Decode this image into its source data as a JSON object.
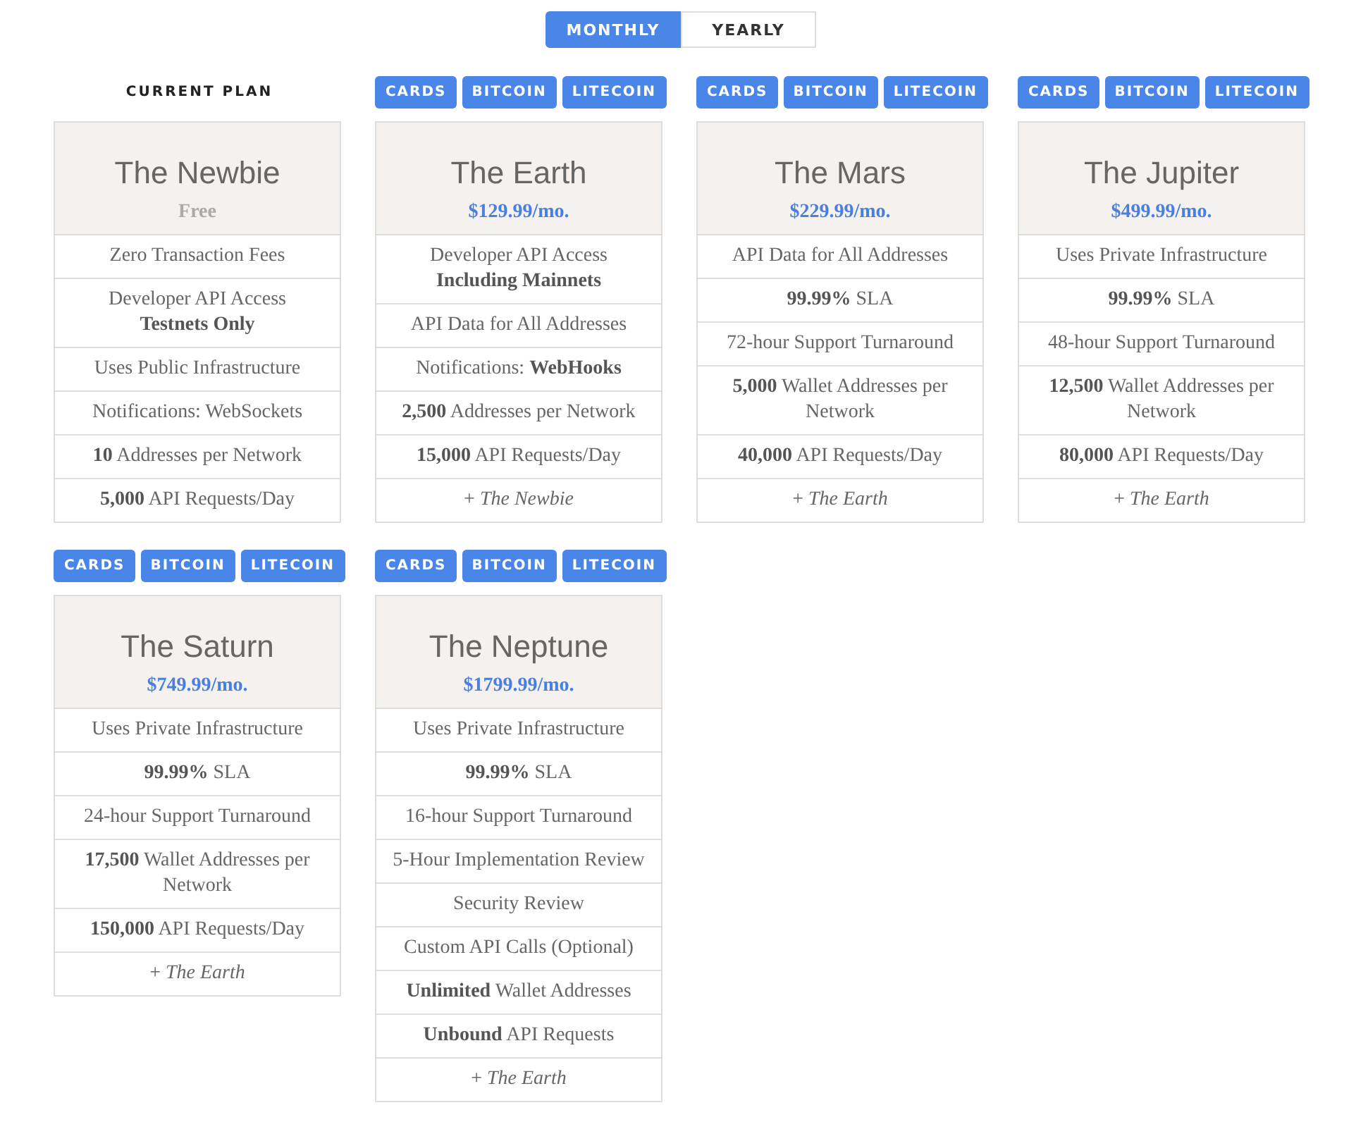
{
  "billing_toggle": [
    {
      "label": "MONTHLY",
      "selected": true
    },
    {
      "label": "YEARLY",
      "selected": false
    }
  ],
  "plans": [
    {
      "kind": "current",
      "label": "CURRENT PLAN",
      "name": "The Newbie",
      "price": "Free",
      "free": true,
      "features": [
        "Zero Transaction Fees",
        "Developer API Access\n**Testnets Only**",
        "Uses Public Infrastructure",
        "Notifications: WebSockets",
        "**10** Addresses per Network",
        "**5,000** API Requests/Day"
      ]
    },
    {
      "kind": "purchasable",
      "payment_buttons": [
        "CARDS",
        "BITCOIN",
        "LITECOIN"
      ],
      "name": "The Earth",
      "price": "$129.99/mo.",
      "free": false,
      "features": [
        "Developer API Access\n**Including Mainnets**",
        "API Data for All Addresses",
        "Notifications: **WebHooks**",
        "**2,500** Addresses per Network",
        "**15,000** API Requests/Day",
        "+ *The Newbie*"
      ]
    },
    {
      "kind": "purchasable",
      "payment_buttons": [
        "CARDS",
        "BITCOIN",
        "LITECOIN"
      ],
      "name": "The Mars",
      "price": "$229.99/mo.",
      "free": false,
      "features": [
        "API Data for All Addresses",
        "**99.99%** SLA",
        "72-hour Support Turnaround",
        "**5,000** Wallet Addresses per Network",
        "**40,000** API Requests/Day",
        "+ *The Earth*"
      ]
    },
    {
      "kind": "purchasable",
      "payment_buttons": [
        "CARDS",
        "BITCOIN",
        "LITECOIN"
      ],
      "name": "The Jupiter",
      "price": "$499.99/mo.",
      "free": false,
      "features": [
        "Uses Private Infrastructure",
        "**99.99%** SLA",
        "48-hour Support Turnaround",
        "**12,500** Wallet Addresses per Network",
        "**80,000** API Requests/Day",
        "+ *The Earth*"
      ]
    },
    {
      "kind": "purchasable",
      "payment_buttons": [
        "CARDS",
        "BITCOIN",
        "LITECOIN"
      ],
      "name": "The Saturn",
      "price": "$749.99/mo.",
      "free": false,
      "features": [
        "Uses Private Infrastructure",
        "**99.99%** SLA",
        "24-hour Support Turnaround",
        "**17,500** Wallet Addresses per Network",
        "**150,000** API Requests/Day",
        "+ *The Earth*"
      ]
    },
    {
      "kind": "purchasable",
      "payment_buttons": [
        "CARDS",
        "BITCOIN",
        "LITECOIN"
      ],
      "name": "The Neptune",
      "price": "$1799.99/mo.",
      "free": false,
      "features": [
        "Uses Private Infrastructure",
        "**99.99%** SLA",
        "16-hour Support Turnaround",
        "5-Hour Implementation Review",
        "Security Review",
        "Custom API Calls (Optional)",
        "**Unlimited** Wallet Addresses",
        "**Unbound** API Requests",
        "+ *The Earth*"
      ]
    }
  ]
}
